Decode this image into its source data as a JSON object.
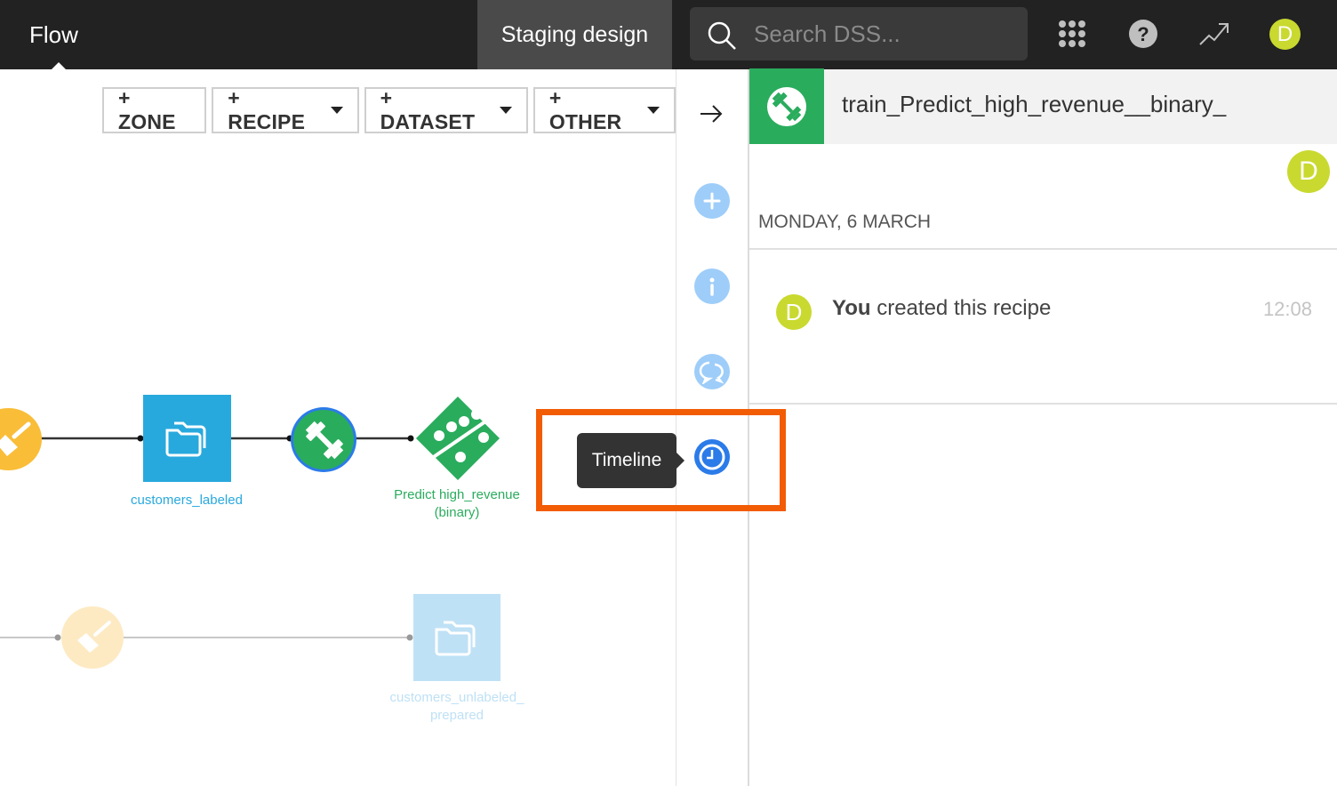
{
  "topbar": {
    "section_title": "Flow",
    "project_tab": "Staging design",
    "search_placeholder": "Search DSS...",
    "icons": [
      "search-icon",
      "apps-grid-icon",
      "help-icon",
      "activity-trend-icon"
    ],
    "user_avatar_initial": "D"
  },
  "flow_toolbar": {
    "buttons": [
      {
        "label": "+ ZONE",
        "has_dropdown": false
      },
      {
        "label": "+ RECIPE",
        "has_dropdown": true
      },
      {
        "label": "+ DATASET",
        "has_dropdown": true
      },
      {
        "label": "+ OTHER",
        "has_dropdown": true
      }
    ]
  },
  "flow_nodes": {
    "prepare_recipe_1": {
      "type": "prepare-recipe",
      "label": ""
    },
    "dataset_customers_labeled": {
      "type": "dataset",
      "label": "customers_labeled"
    },
    "train_recipe": {
      "type": "train-recipe",
      "label": "",
      "selected": true
    },
    "saved_model": {
      "type": "saved-model",
      "label_line1": "Predict high_revenue",
      "label_line2": "(binary)"
    },
    "prepare_recipe_2": {
      "type": "prepare-recipe",
      "label": "",
      "faded": true
    },
    "dataset_customers_unlabeled_prepared": {
      "type": "dataset",
      "label_line1": "customers_unlabeled_",
      "label_line2": "prepared",
      "faded": true
    }
  },
  "side_nav": {
    "collapse_icon": "arrow-right-icon",
    "items": [
      {
        "name": "actions",
        "icon": "plus-icon"
      },
      {
        "name": "details",
        "icon": "info-icon"
      },
      {
        "name": "discussions",
        "icon": "chat-icon"
      },
      {
        "name": "timeline",
        "icon": "clock-icon",
        "active": true
      }
    ],
    "tooltip": "Timeline"
  },
  "panel": {
    "title": "train_Predict_high_revenue__binary_",
    "header_icon": "train-recipe-icon",
    "author_initial": "D",
    "date_heading": "MONDAY, 6 MARCH",
    "events": [
      {
        "actor": "You",
        "action": "created this recipe",
        "time": "12:08",
        "avatar_initial": "D"
      }
    ]
  },
  "colors": {
    "topbar_bg": "#222222",
    "accent_green": "#2aac5d",
    "dataset_blue": "#28a9dd",
    "prepare_yellow": "#f9bd38",
    "avatar_lime": "#c9d92f",
    "highlight_orange": "#f25c05",
    "sidebar_icon_blue": "#9ecdf9",
    "active_icon_blue": "#2b7be9"
  }
}
